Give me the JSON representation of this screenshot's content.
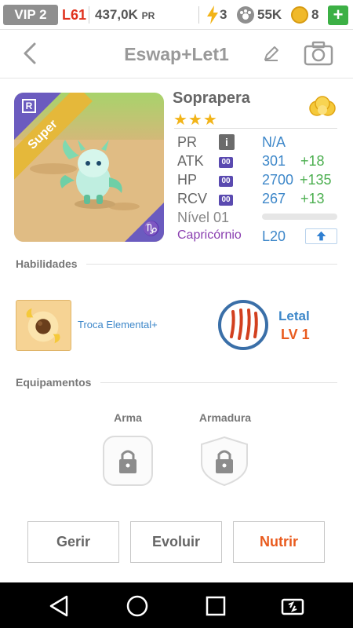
{
  "status": {
    "vip": "VIP 2",
    "level": "L61",
    "power": "437,0K",
    "power_unit": "PR",
    "energy": "3",
    "paw": "55K",
    "coins": "8",
    "plus": "+"
  },
  "header": {
    "title": "Eswap+Let1"
  },
  "pet": {
    "name": "Soprapera",
    "stars": "★★★",
    "rarity": "R",
    "ribbon": "Super",
    "zodiac_symbol": "♑",
    "stats": {
      "pr_label": "PR",
      "pr_value": "N/A",
      "atk_label": "ATK",
      "atk_value": "301",
      "atk_bonus": "+18",
      "hp_label": "HP",
      "hp_value": "2700",
      "hp_bonus": "+135",
      "rcv_label": "RCV",
      "rcv_value": "267",
      "rcv_bonus": "+13",
      "badge": "00",
      "info": "i",
      "level_label": "Nível 01",
      "sign_label": "Capricórnio",
      "sign_level": "L20"
    },
    "xp_fraction": 0.0
  },
  "skills": {
    "section_title": "Habilidades",
    "active_name": "Troca Elemental+",
    "passive_name": "Letal",
    "passive_level": "LV 1"
  },
  "equipment": {
    "section_title": "Equipamentos",
    "weapon_label": "Arma",
    "armor_label": "Armadura"
  },
  "actions": {
    "manage": "Gerir",
    "evolve": "Evoluir",
    "feed": "Nutrir"
  },
  "colors": {
    "accent_blue": "#3d87c9",
    "bonus_green": "#4caf50",
    "feed_orange": "#e95b1e",
    "star_gold": "#f2b418"
  }
}
